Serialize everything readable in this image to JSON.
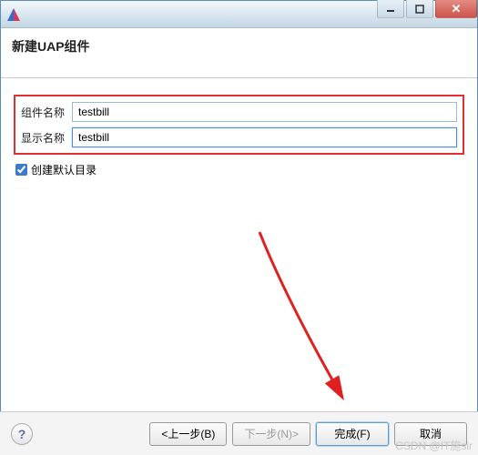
{
  "window": {
    "title": ""
  },
  "banner": {
    "title": "新建UAP组件"
  },
  "fields": {
    "component_name_label": "组件名称",
    "component_name_value": "testbill",
    "display_name_label": "显示名称",
    "display_name_value": "testbill"
  },
  "checkbox": {
    "create_default_dirs_label": "创建默认目录",
    "checked": true
  },
  "buttons": {
    "help_label": "?",
    "back_label": "<上一步(B)",
    "next_label": "下一步(N)>",
    "finish_label": "完成(F)",
    "cancel_label": "取消"
  },
  "watermark": "CSDN @IT施sir"
}
